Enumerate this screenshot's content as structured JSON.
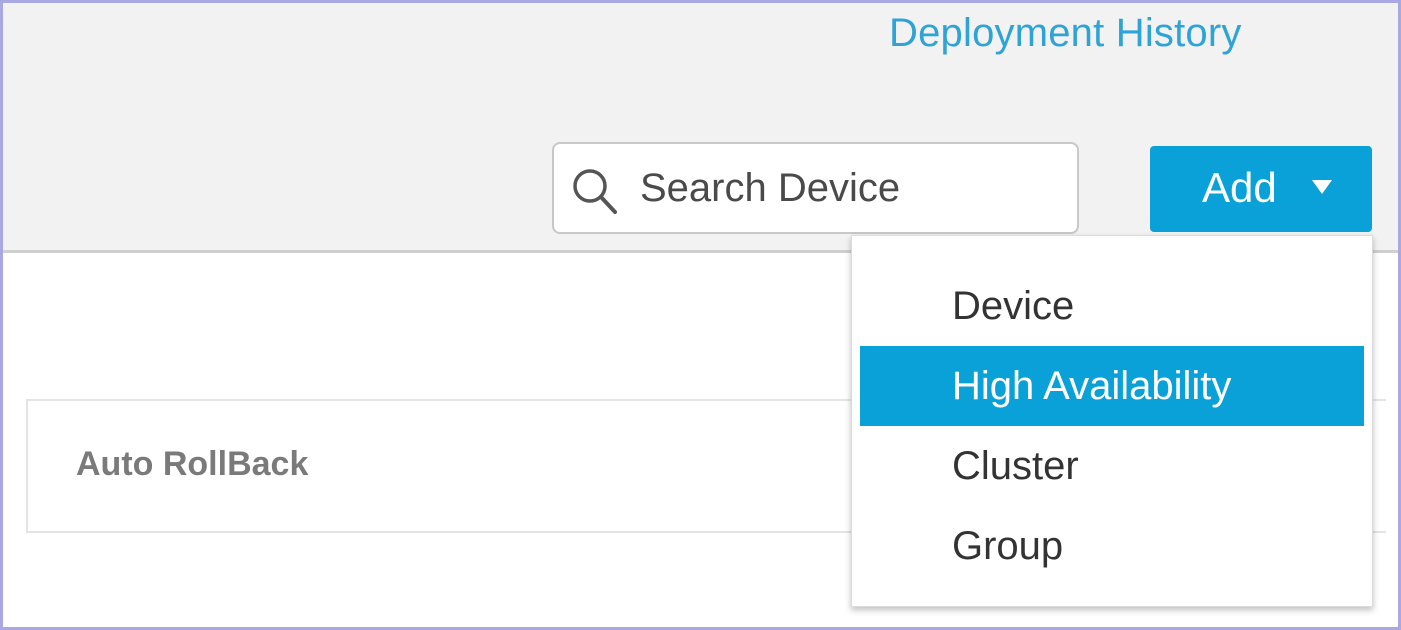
{
  "header": {
    "deployment_history_label": "Deployment History"
  },
  "search": {
    "placeholder": "Search Device",
    "value": ""
  },
  "add_button": {
    "label": "Add"
  },
  "add_menu": {
    "items": [
      {
        "label": "Device",
        "active": false
      },
      {
        "label": "High Availability",
        "active": true
      },
      {
        "label": "Cluster",
        "active": false
      },
      {
        "label": "Group",
        "active": false
      }
    ]
  },
  "table": {
    "columns": [
      "Auto RollBack"
    ]
  },
  "colors": {
    "accent": "#0aa1d8",
    "link": "#2ea3d6",
    "toolbar_bg": "#f2f2f2"
  }
}
